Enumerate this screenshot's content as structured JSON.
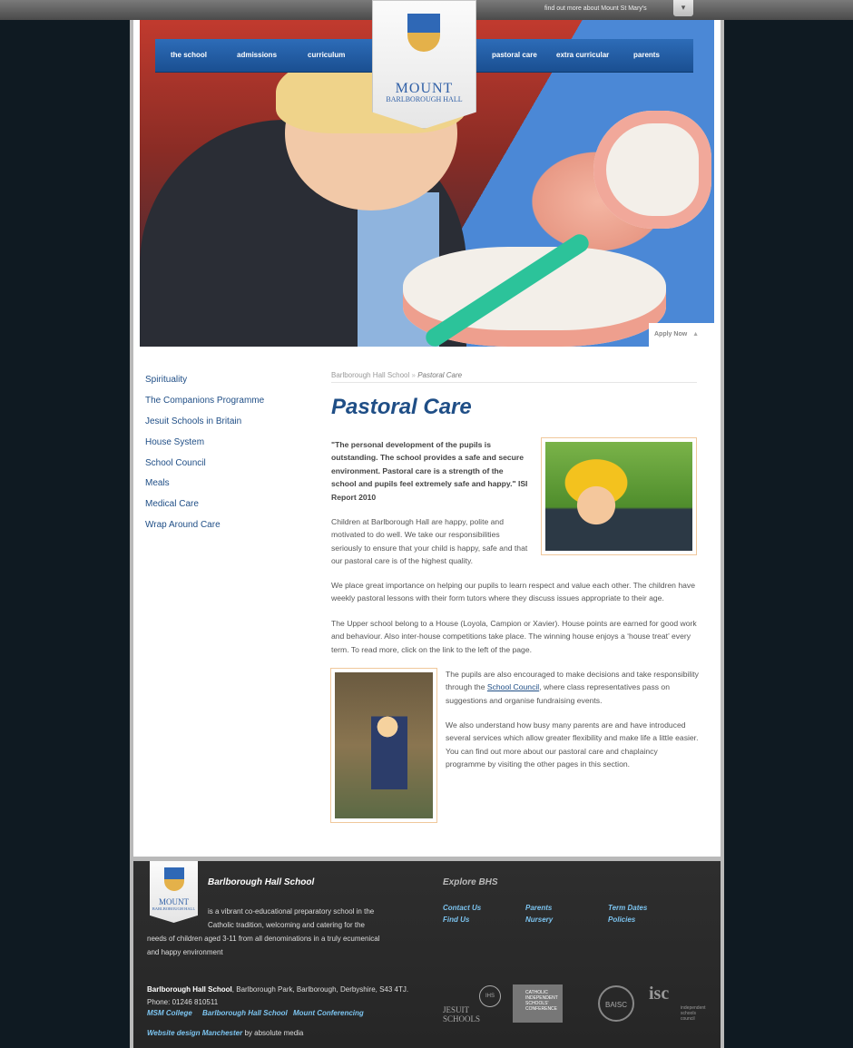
{
  "topbar": {
    "find_more": "find out more about Mount St Mary's",
    "dropdown_icon": "▾"
  },
  "nav": {
    "left": [
      "the school",
      "admissions",
      "curriculum"
    ],
    "right": [
      "pastoral care",
      "extra curricular",
      "parents"
    ]
  },
  "crest": {
    "wordmark": "MOUNT",
    "sub": "BARLBOROUGH HALL"
  },
  "hero": {
    "apply_now": "Apply Now",
    "apply_icon": "▲"
  },
  "sidebar": {
    "items": [
      "Spirituality",
      "The Companions Programme",
      "Jesuit Schools in Britain",
      "House System",
      "School Council",
      "Meals",
      "Medical Care",
      "Wrap Around Care"
    ]
  },
  "breadcrumb": {
    "home": "Barlborough Hall School",
    "sep": "»",
    "current": "Pastoral Care"
  },
  "main": {
    "title": "Pastoral Care",
    "quote": "\"The personal development of the pupils is outstanding. The school provides a safe and secure environment. Pastoral care is a strength of the school and pupils feel extremely safe and happy.\"",
    "quote_source": "ISI Report 2010",
    "p1": "Children at Barlborough Hall are happy, polite and motivated to do well. We take our responsibilities seriously to ensure that your child is happy, safe and that our pastoral care is of the highest quality.",
    "p2": "We place great importance on helping our pupils to learn respect and value each other. The children have weekly pastoral lessons with their form tutors where they discuss issues appropriate to their age.",
    "p3": "The Upper school belong to a House (Loyola, Campion or Xavier). House points are earned for good work and behaviour. Also inter-house competitions take place. The winning house enjoys a ‘house treat’ every term. To read more, click on the link to the left of the page.",
    "p4_before": "The pupils are also encouraged to make decisions and take responsibility through the ",
    "p4_link": "School Council",
    "p4_after": ", where class representatives pass on suggestions and organise fundraising events.",
    "p5": "We also understand how busy many parents are and have introduced several services which allow greater flexibility and make life a little easier. You can find out more about our pastoral care and chaplaincy programme by visiting the other pages in this section."
  },
  "footer": {
    "crest_wordmark": "MOUNT",
    "crest_sub": "BARLBOROUGH HALL",
    "title": "Barlborough Hall School",
    "desc_line1": "is a vibrant co-educational preparatory school in the",
    "desc_line2": "Catholic tradition, welcoming and catering for the",
    "desc_line3": "needs of children aged 3-11 from all denominations in a truly ecumenical",
    "desc_line4": "and happy environment",
    "explore_title": "Explore BHS",
    "links": [
      "Contact Us",
      "Parents",
      "Term Dates",
      "Find Us",
      "Nursery",
      "Policies"
    ],
    "address_name": "Barlborough Hall School",
    "address_rest": ", Barlborough Park, Barlborough, Derbyshire, S43 4TJ.",
    "phone": "Phone: 01246 810511",
    "bottom_links": [
      "MSM College",
      "Barlborough Hall School",
      "Mount Conferencing"
    ],
    "design_link": "Website design Manchester",
    "design_rest": " by absolute media",
    "logos": {
      "jesuit_circle": "IHS",
      "jesuit_text": "JESUIT SCHOOLS",
      "cisc": "CATHOLIC INDEPENDENT SCHOOLS' CONFERENCE",
      "baisc": "BAISC",
      "isc_big": "isc",
      "isc_small": "independent schools council"
    }
  }
}
